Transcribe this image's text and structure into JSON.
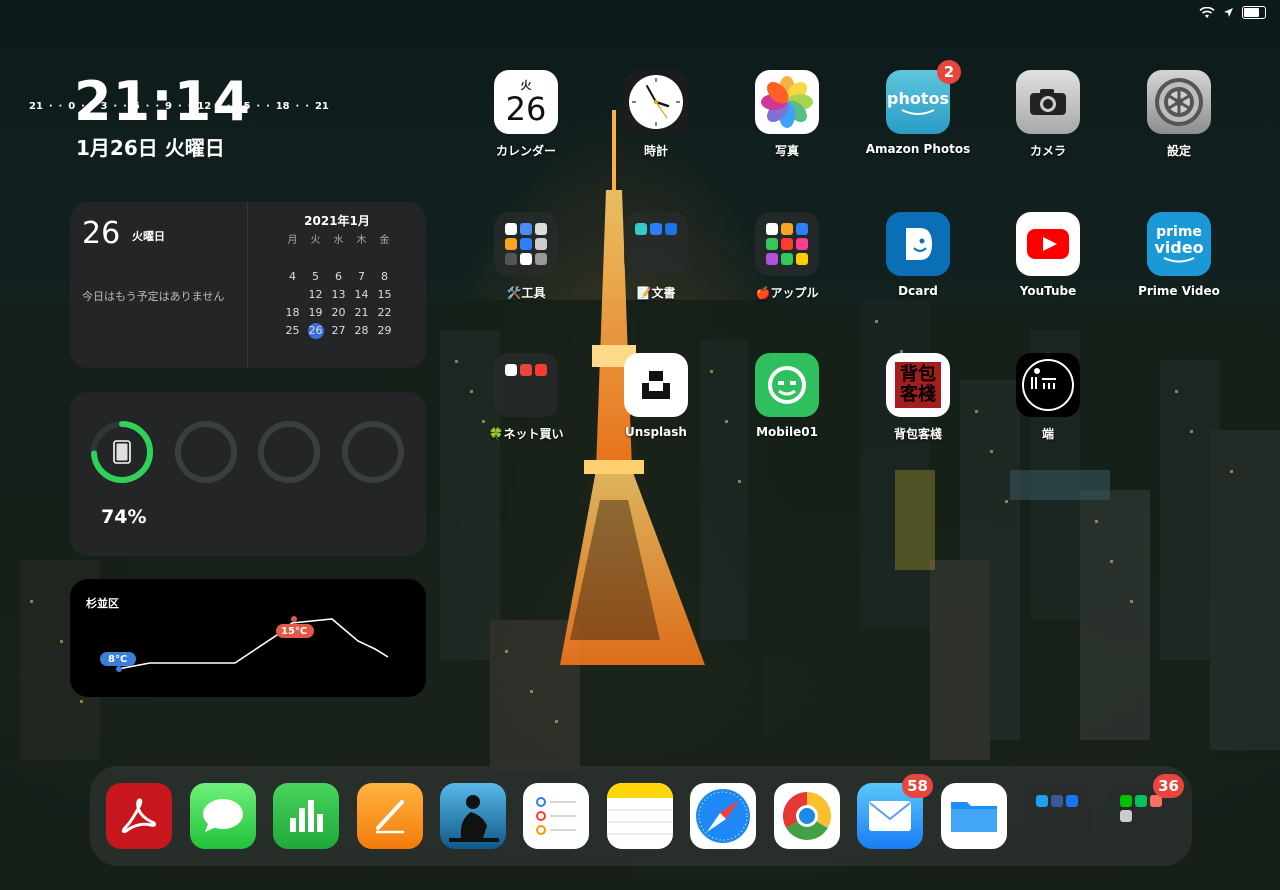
{
  "status_bar": {
    "wifi_icon": "wifi-icon",
    "location_icon": "location-arrow-icon",
    "battery_icon": "battery-icon"
  },
  "clock": {
    "time": "21:14",
    "date": "1月26日 火曜日"
  },
  "calendar_widget": {
    "day": "26",
    "weekday": "火曜日",
    "no_events": "今日はもう予定はありません",
    "month_title": "2021年1月",
    "weekday_headers": [
      "月",
      "火",
      "水",
      "木",
      "金"
    ],
    "weeks": [
      [
        "",
        "",
        "",
        "",
        ""
      ],
      [
        "4",
        "5",
        "6",
        "7",
        "8"
      ],
      [
        "",
        "12",
        "13",
        "14",
        "15"
      ],
      [
        "18",
        "19",
        "20",
        "21",
        "22"
      ],
      [
        "25",
        "26",
        "27",
        "28",
        "29"
      ]
    ],
    "today": "26"
  },
  "battery_widget": {
    "percent": "74%",
    "level": 0.74,
    "device_icon": "ipad-icon",
    "accent": "#30d158"
  },
  "weather_widget": {
    "location": "杉並区",
    "low_label": "8°C",
    "high_label": "15°C",
    "hours": [
      "21",
      "·",
      "·",
      "0",
      "·",
      "·",
      "3",
      "·",
      "·",
      "6",
      "·",
      "·",
      "9",
      "·",
      "·",
      "12",
      "·",
      "·",
      "15",
      "·",
      "·",
      "18",
      "·",
      "·",
      "21"
    ]
  },
  "apps": [
    {
      "name": "calendar",
      "label": "カレンダー",
      "icon_day": "火",
      "icon_num": "26"
    },
    {
      "name": "clock",
      "label": "時計"
    },
    {
      "name": "photos",
      "label": "写真"
    },
    {
      "name": "amazon-photos",
      "label": "Amazon Photos",
      "icon_text": "photos",
      "badge": "2"
    },
    {
      "name": "camera",
      "label": "カメラ"
    },
    {
      "name": "settings",
      "label": "設定"
    },
    {
      "name": "folder-tools",
      "label": "🛠️工具"
    },
    {
      "name": "folder-docs",
      "label": "📝文書"
    },
    {
      "name": "folder-apple",
      "label": "🍎アップル"
    },
    {
      "name": "dcard",
      "label": "Dcard"
    },
    {
      "name": "youtube",
      "label": "YouTube"
    },
    {
      "name": "prime-video",
      "label": "Prime Video",
      "icon_text_1": "prime",
      "icon_text_2": "video"
    },
    {
      "name": "folder-shopping",
      "label": "🍀ネット買い"
    },
    {
      "name": "unsplash",
      "label": "Unsplash"
    },
    {
      "name": "mobile01",
      "label": "Mobile01"
    },
    {
      "name": "backpackers",
      "label": "背包客棧",
      "icon_text": "背包客棧"
    },
    {
      "name": "duan",
      "label": "端"
    }
  ],
  "dock": [
    {
      "name": "acrobat",
      "icon": "acrobat-icon"
    },
    {
      "name": "messages",
      "icon": "message-bubble-icon"
    },
    {
      "name": "numbers",
      "icon": "bar-chart-icon"
    },
    {
      "name": "pages",
      "icon": "pencil-icon"
    },
    {
      "name": "kindle",
      "icon": "kindle-reader-icon"
    },
    {
      "name": "reminders",
      "icon": "checklist-icon"
    },
    {
      "name": "notes",
      "icon": "notes-icon"
    },
    {
      "name": "safari",
      "icon": "compass-icon"
    },
    {
      "name": "chrome",
      "icon": "chrome-icon"
    },
    {
      "name": "mail",
      "icon": "envelope-icon",
      "badge": "58"
    },
    {
      "name": "files",
      "icon": "folder-icon"
    },
    {
      "name": "social-folder",
      "icon": "folder-grid-icon"
    },
    {
      "name": "chat-folder",
      "icon": "folder-grid-icon",
      "badge": "36"
    }
  ]
}
